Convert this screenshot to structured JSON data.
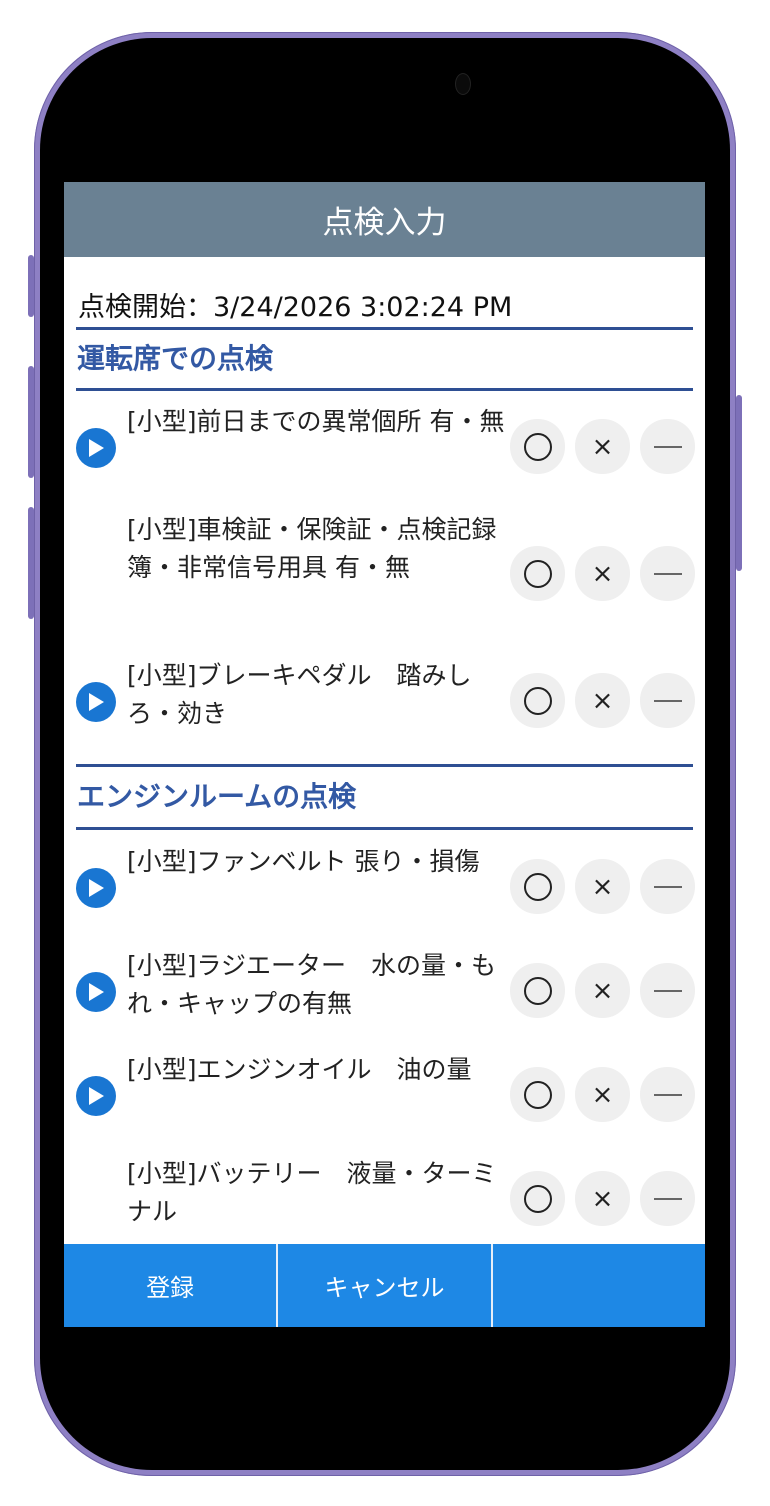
{
  "header": {
    "title": "点検入力"
  },
  "start": {
    "label": "点検開始：",
    "value": "3/24/2026 3:02:24 PM"
  },
  "sections": [
    {
      "title": "運転席での点検",
      "items": [
        {
          "text": "[小型]前日までの異常個所 有・無",
          "has_play": true
        },
        {
          "text": "[小型]車検証・保険証・点検記録簿・非常信号用具 有・無",
          "has_play": false
        },
        {
          "text": "[小型]ブレーキペダル　踏みしろ・効き",
          "has_play": true
        }
      ]
    },
    {
      "title": "エンジンルームの点検",
      "items": [
        {
          "text": "[小型]ファンベルト 張り・損傷",
          "has_play": true
        },
        {
          "text": "[小型]ラジエーター　水の量・もれ・キャップの有無",
          "has_play": true
        },
        {
          "text": "[小型]エンジンオイル　油の量",
          "has_play": true
        },
        {
          "text": "[小型]バッテリー　液量・ターミナル",
          "has_play": false
        }
      ]
    }
  ],
  "choice_labels": {
    "ok": "〇",
    "ng": "×",
    "na": "—"
  },
  "footer": {
    "register": "登録",
    "cancel": "キャンセル",
    "third": ""
  },
  "colors": {
    "titlebar": "#6a8193",
    "accent": "#1e88e5",
    "section": "#3359a4",
    "rule": "#2e4f93"
  },
  "icons": {
    "play": "play-circle-icon"
  }
}
